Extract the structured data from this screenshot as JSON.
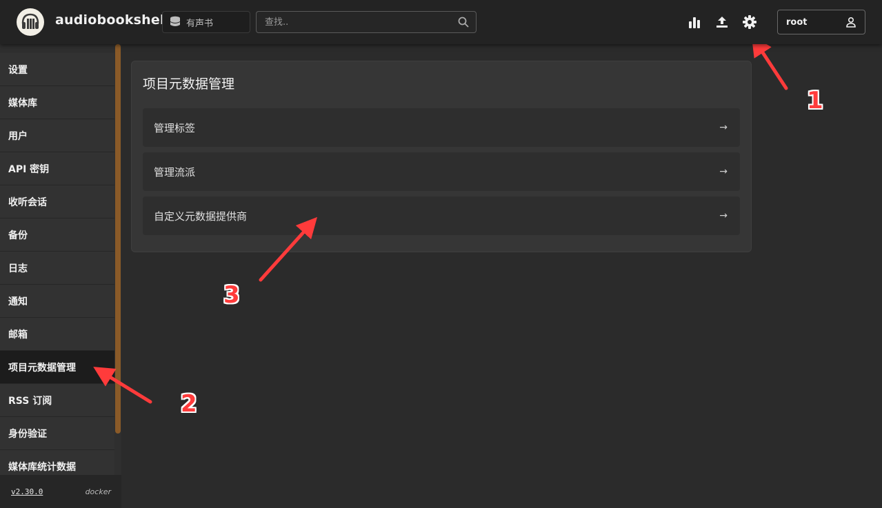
{
  "header": {
    "app_title": "audiobookshelf",
    "library_selector": {
      "label": "有声书",
      "icon": "database-icon"
    },
    "search": {
      "placeholder": "查找.."
    },
    "icons": [
      "stats-icon",
      "upload-icon",
      "settings-icon"
    ],
    "user": {
      "name": "root",
      "icon": "user-icon"
    }
  },
  "sidebar": {
    "items": [
      {
        "label": "设置"
      },
      {
        "label": "媒体库"
      },
      {
        "label": "用户"
      },
      {
        "label": "API 密钥"
      },
      {
        "label": "收听会话"
      },
      {
        "label": "备份"
      },
      {
        "label": "日志"
      },
      {
        "label": "通知"
      },
      {
        "label": "邮箱"
      },
      {
        "label": "项目元数据管理"
      },
      {
        "label": "RSS 订阅"
      },
      {
        "label": "身份验证"
      },
      {
        "label": "媒体库统计数据"
      }
    ],
    "active_item": "项目元数据管理",
    "version": "v2.30.0",
    "build": "docker"
  },
  "main": {
    "title": "项目元数据管理",
    "rows": [
      {
        "label": "管理标签",
        "arrow": "→"
      },
      {
        "label": "管理流派",
        "arrow": "→"
      },
      {
        "label": "自定义元数据提供商",
        "arrow": "→"
      }
    ]
  },
  "annotations": {
    "color": "#ff3b3b",
    "labels": [
      "1",
      "2",
      "3"
    ]
  }
}
